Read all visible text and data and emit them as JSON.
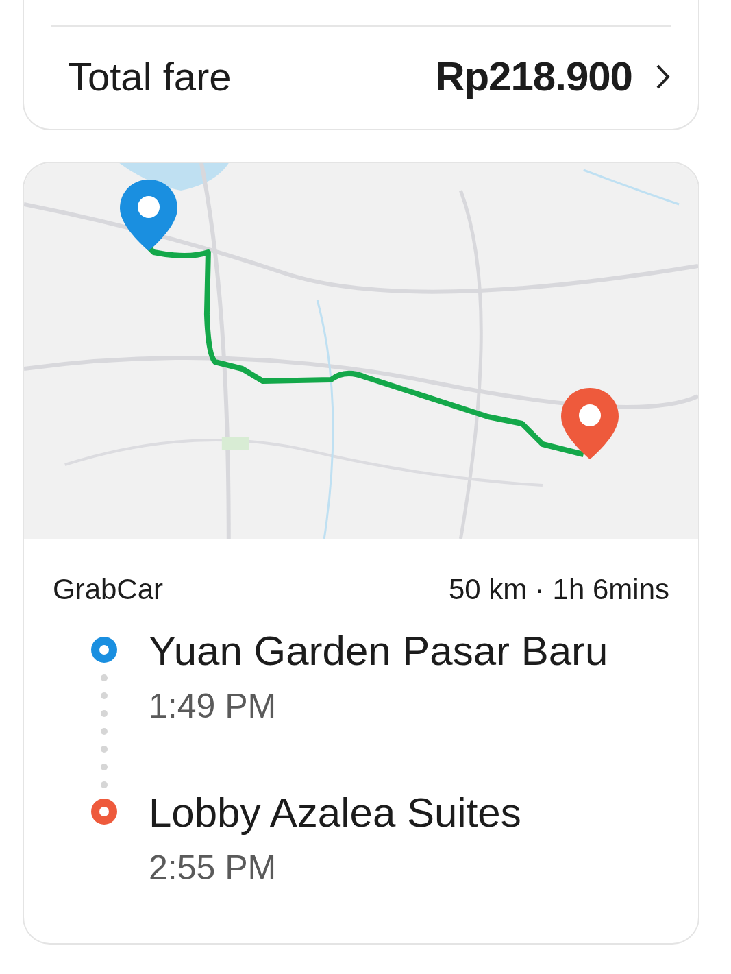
{
  "fare": {
    "label": "Total fare",
    "amount": "Rp218.900"
  },
  "trip": {
    "service": "GrabCar",
    "summary": "50 km · 1h 6mins",
    "stops": [
      {
        "color": "#1a8fe0",
        "name": "Yuan Garden Pasar Baru",
        "time": "1:49 PM"
      },
      {
        "color": "#ee5a3c",
        "name": "Lobby Azalea Suites",
        "time": "2:55 PM"
      }
    ]
  }
}
